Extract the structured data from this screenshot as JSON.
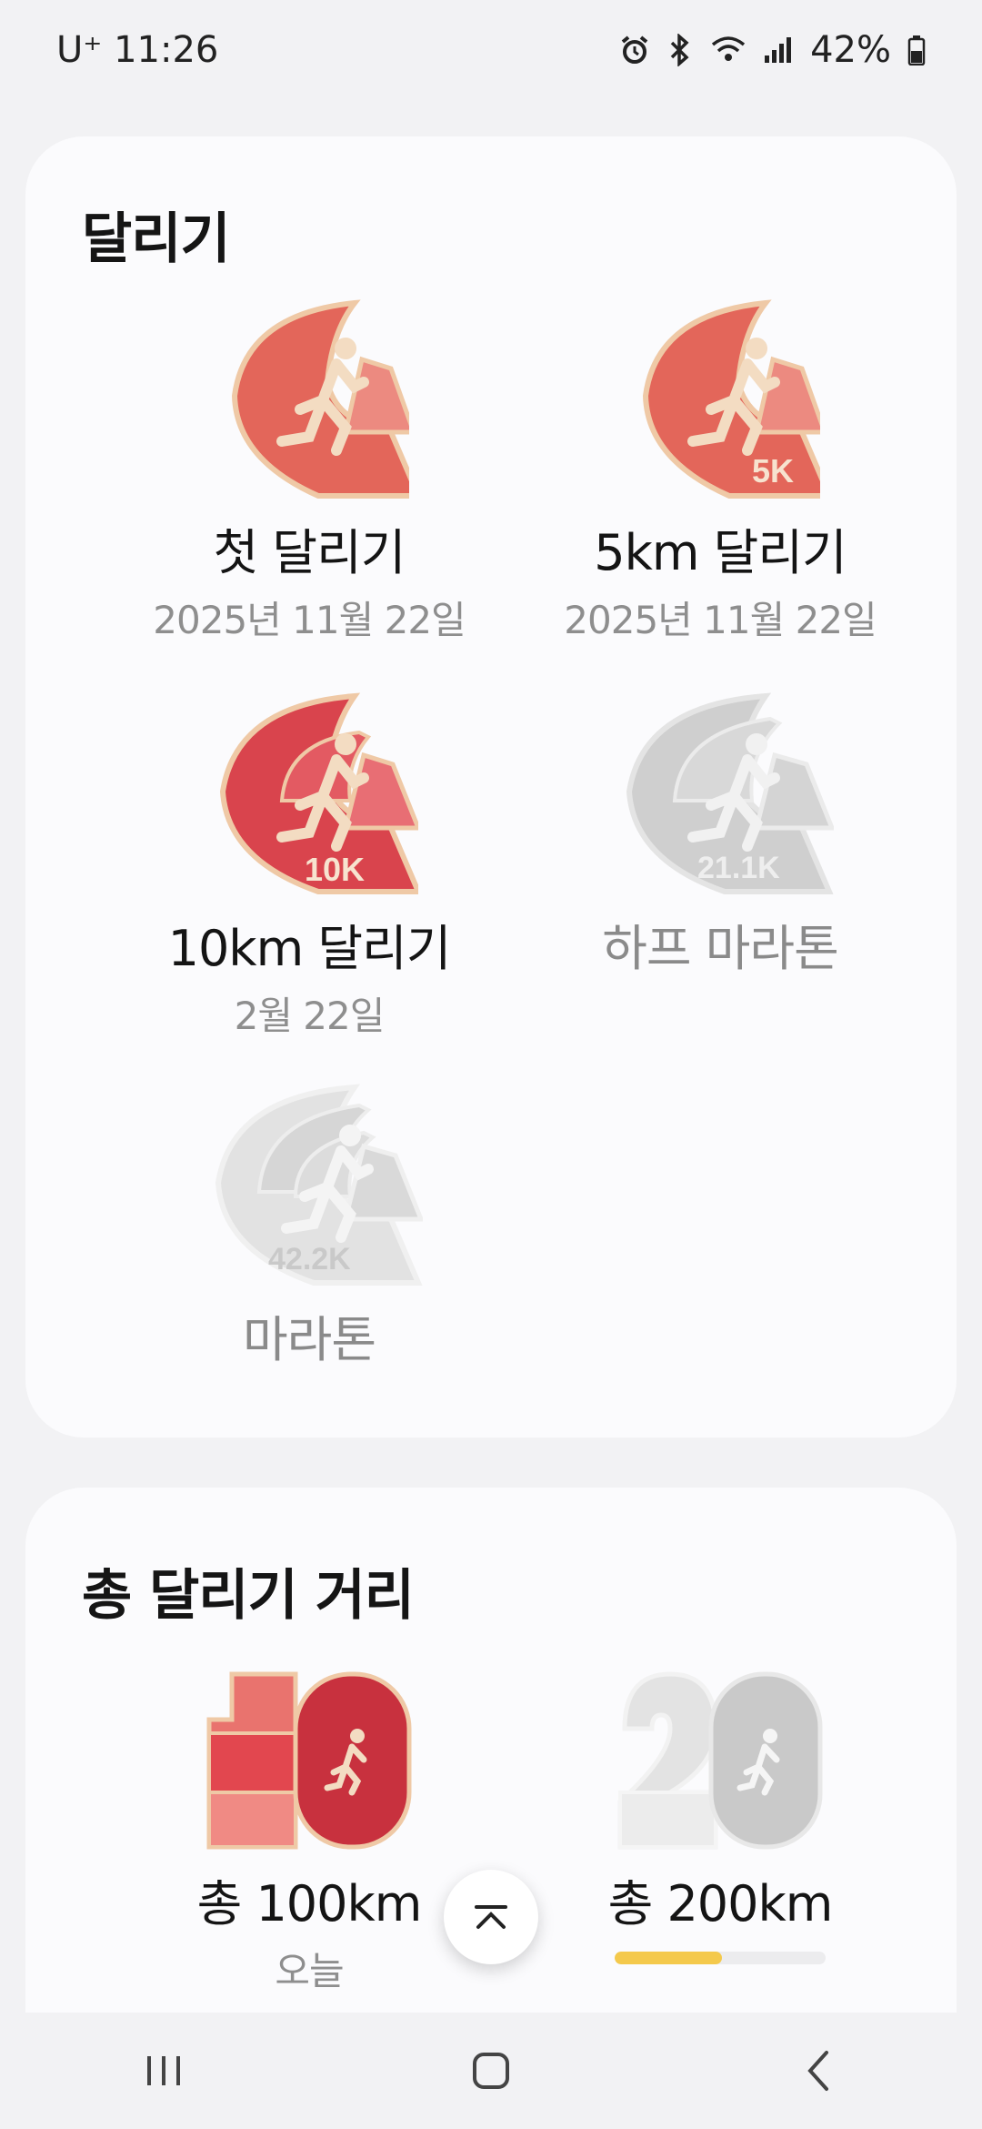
{
  "status": {
    "carrier": "U⁺ 11:26",
    "battery": "42%"
  },
  "running": {
    "title": "달리기",
    "badges": [
      {
        "name": "첫 달리기",
        "date": "2025년 11월 22일",
        "locked": false,
        "icon": "first-run-badge-icon"
      },
      {
        "name": "5km 달리기",
        "date": "2025년 11월 22일",
        "locked": false,
        "icon": "5k-badge-icon",
        "badge_text": "5K"
      },
      {
        "name": "10km 달리기",
        "date": "2월 22일",
        "locked": false,
        "icon": "10k-badge-icon",
        "badge_text": "10K"
      },
      {
        "name": "하프 마라톤",
        "date": "",
        "locked": true,
        "icon": "half-marathon-badge-icon",
        "badge_text": "21.1K"
      },
      {
        "name": "마라톤",
        "date": "",
        "locked": true,
        "icon": "marathon-badge-icon",
        "badge_text": "42.2K"
      }
    ]
  },
  "distance": {
    "title": "총 달리기 거리",
    "badges": [
      {
        "name": "총 100km",
        "date": "오늘",
        "locked": false,
        "icon": "100km-badge-icon",
        "digit": "1"
      },
      {
        "name": "총 200km",
        "locked": true,
        "icon": "200km-badge-icon",
        "digit": "2",
        "progress": 0.51
      }
    ]
  },
  "colors": {
    "accent_red": "#e0584f",
    "locked_gray": "#cfcfcf",
    "progress_yellow": "#f4c94c"
  }
}
